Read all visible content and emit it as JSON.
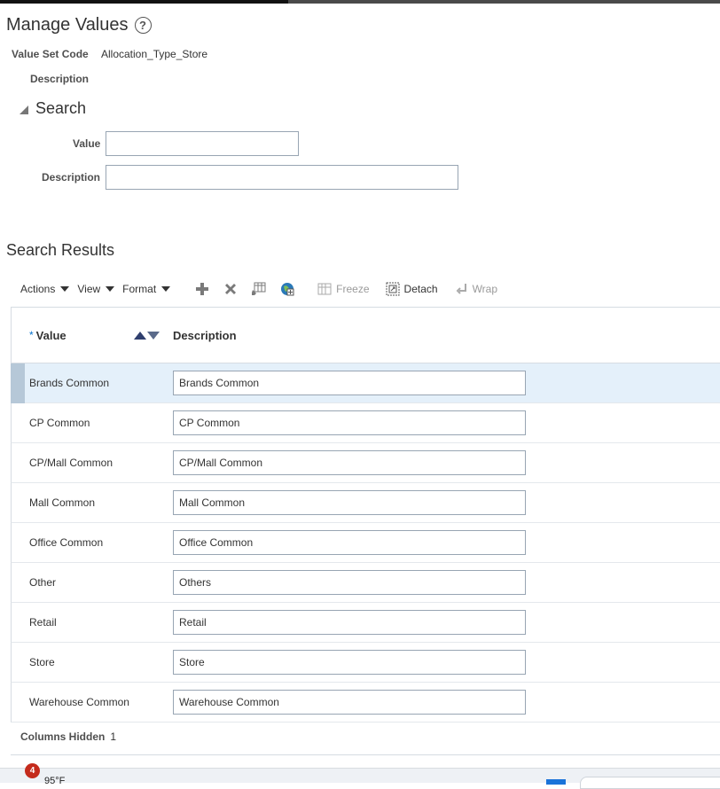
{
  "page": {
    "title": "Manage Values",
    "help_icon": "help-icon"
  },
  "header": {
    "value_set_code_label": "Value Set Code",
    "value_set_code": "Allocation_Type_Store",
    "description_label": "Description",
    "description": ""
  },
  "search": {
    "title": "Search",
    "value_label": "Value",
    "value_input": "",
    "description_label": "Description",
    "description_input": ""
  },
  "results": {
    "title": "Search Results",
    "toolbar": {
      "actions": "Actions",
      "view": "View",
      "format": "Format",
      "freeze": "Freeze",
      "detach": "Detach",
      "wrap": "Wrap"
    },
    "columns": {
      "required_marker": "*",
      "value": "Value",
      "description": "Description"
    },
    "rows": [
      {
        "value": "Brands Common",
        "description": "Brands Common"
      },
      {
        "value": "CP Common",
        "description": "CP Common"
      },
      {
        "value": "CP/Mall Common",
        "description": "CP/Mall Common"
      },
      {
        "value": "Mall Common",
        "description": "Mall Common"
      },
      {
        "value": "Office Common",
        "description": "Office Common"
      },
      {
        "value": "Other",
        "description": "Others"
      },
      {
        "value": "Retail",
        "description": "Retail"
      },
      {
        "value": "Store",
        "description": "Store"
      },
      {
        "value": "Warehouse Common",
        "description": "Warehouse Common"
      }
    ],
    "selected_row_index": 0,
    "columns_hidden_label": "Columns Hidden",
    "columns_hidden_count": "1"
  },
  "taskbar": {
    "notification_count": "4",
    "temperature": "95°F"
  },
  "colors": {
    "selected_row": "#e4f0fa",
    "required_marker": "#0572ce",
    "input_border": "#98a5b3"
  }
}
